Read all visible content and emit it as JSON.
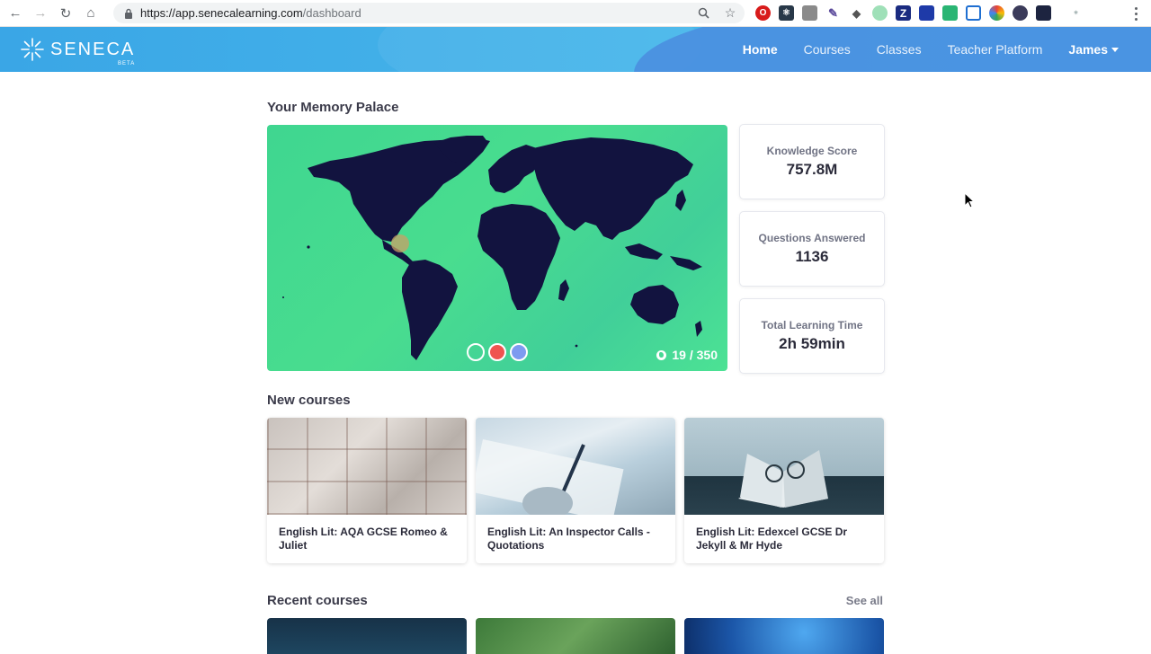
{
  "browser": {
    "url_host": "https://app.senecalearning.com",
    "url_path": "/dashboard",
    "extension_letters": [
      "Z"
    ]
  },
  "header": {
    "logo_text": "SENECA",
    "logo_badge": "BETA",
    "nav": [
      "Home",
      "Courses",
      "Classes",
      "Teacher Platform"
    ],
    "user": "James"
  },
  "memory": {
    "title": "Your Memory Palace",
    "progress": "19 / 350"
  },
  "stats": [
    {
      "label": "Knowledge Score",
      "value": "757.8M"
    },
    {
      "label": "Questions Answered",
      "value": "1136"
    },
    {
      "label": "Total Learning Time",
      "value": "2h 59min"
    }
  ],
  "new_courses": {
    "title": "New courses",
    "items": [
      {
        "name": "English Lit: AQA GCSE Romeo & Juliet"
      },
      {
        "name": "English Lit: An Inspector Calls - Quotations"
      },
      {
        "name": "English Lit: Edexcel GCSE Dr Jekyll & Mr Hyde"
      }
    ]
  },
  "recent_courses": {
    "title": "Recent courses",
    "see_all": "See all"
  },
  "colors": {
    "header_start": "#3aa6e6",
    "map_green": "#45d994",
    "land": "#12133f",
    "dot_red": "#ef5350",
    "dot_blue": "#7d9bf0"
  }
}
